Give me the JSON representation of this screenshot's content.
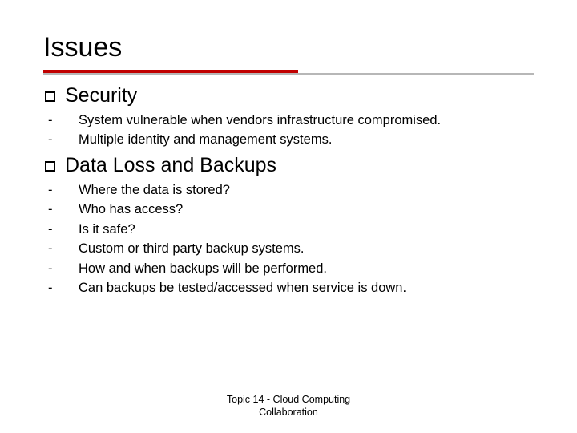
{
  "title": "Issues",
  "sections": [
    {
      "heading": "Security",
      "items": [
        "System vulnerable when vendors infrastructure compromised.",
        "Multiple identity and management systems."
      ]
    },
    {
      "heading": "Data Loss and Backups",
      "items": [
        "Where the data is stored?",
        "Who has access?",
        "Is it safe?",
        "Custom or third party backup systems.",
        "How and when backups will be performed.",
        "Can backups be tested/accessed when service is down."
      ]
    }
  ],
  "footer_line1": "Topic 14 - Cloud Computing",
  "footer_line2": "Collaboration"
}
